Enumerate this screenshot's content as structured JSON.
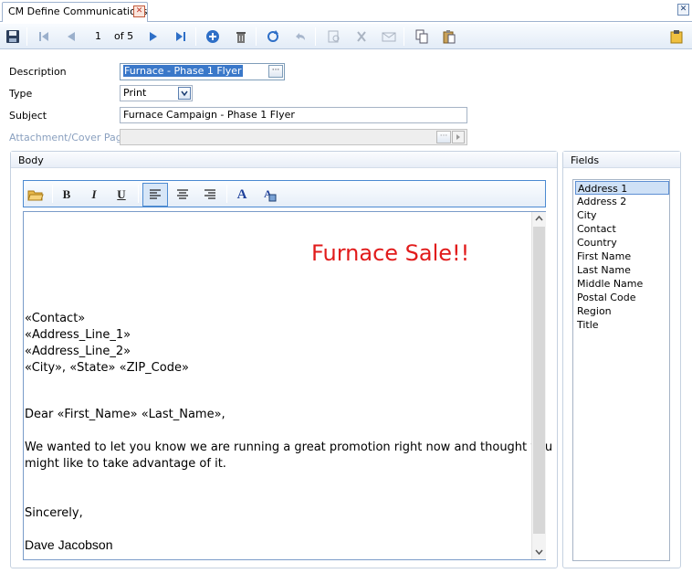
{
  "tab": {
    "title": "CM Define Communications",
    "close_glyph": "✕"
  },
  "window": {
    "close_glyph": "✕"
  },
  "toolbar": {
    "record_position": "1",
    "record_of": "of 5",
    "icons": [
      "save-icon",
      "first-record-icon",
      "prev-record-icon",
      "next-record-icon",
      "last-record-icon",
      "add-icon",
      "delete-icon",
      "refresh-icon",
      "undo-icon",
      "preview-icon",
      "clear-icon",
      "envelope-icon",
      "copy-icon",
      "paste-icon",
      "notes-icon"
    ]
  },
  "form": {
    "description_label": "Description",
    "description_value": "Furnace - Phase 1 Flyer",
    "type_label": "Type",
    "type_value": "Print",
    "subject_label": "Subject",
    "subject_value": "Furnace Campaign - Phase 1 Flyer",
    "attachment_label": "Attachment/Cover Page",
    "attachment_value": ""
  },
  "body_panel": {
    "title": "Body",
    "editor": {
      "heading": "Furnace Sale!!",
      "lines": [
        "«Contact»",
        "«Address_Line_1»",
        "«Address_Line_2»",
        "«City», «State» «ZIP_Code»",
        "Dear «First_Name» «Last_Name»,",
        "We wanted to let you know we are running a great promotion right now and thought you",
        "might like to take advantage of it.",
        "Sincerely,",
        "Dave Jacobson"
      ]
    }
  },
  "fields_panel": {
    "title": "Fields",
    "items": [
      "Address 1",
      "Address 2",
      "City",
      "Contact",
      "Country",
      "First Name",
      "Last Name",
      "Middle Name",
      "Postal Code",
      "Region",
      "Title"
    ],
    "selected": "Address 1"
  },
  "colors": {
    "heading": "#e11b1b",
    "selection": "#3a78c9",
    "accent": "#4c8ad1"
  }
}
